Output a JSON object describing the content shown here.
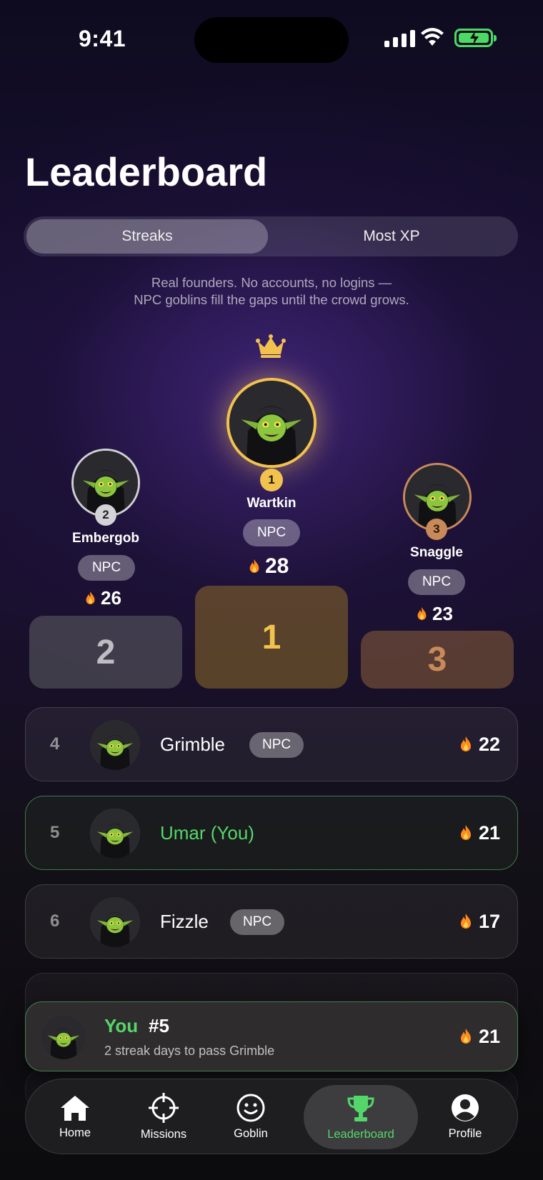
{
  "status_bar": {
    "time": "9:41"
  },
  "page": {
    "title": "Leaderboard",
    "tabs": [
      {
        "label": "Streaks",
        "active": true
      },
      {
        "label": "Most XP",
        "active": false
      }
    ],
    "note_line1": "Real founders. No accounts, no logins —",
    "note_line2": "NPC goblins fill the gaps until the crowd grows."
  },
  "podium": {
    "first": {
      "rank": "1",
      "name": "Wartkin",
      "badge": "NPC",
      "streak": "28",
      "block_label": "1"
    },
    "second": {
      "rank": "2",
      "name": "Embergob",
      "badge": "NPC",
      "streak": "26",
      "block_label": "2"
    },
    "third": {
      "rank": "3",
      "name": "Snaggle",
      "badge": "NPC",
      "streak": "23",
      "block_label": "3"
    }
  },
  "list": [
    {
      "rank": "4",
      "name": "Grimble",
      "badge": "NPC",
      "streak": "22"
    },
    {
      "rank": "5",
      "name": "Umar (You)",
      "badge": "",
      "streak": "21",
      "is_you": true
    },
    {
      "rank": "6",
      "name": "Fizzle",
      "badge": "NPC",
      "streak": "17"
    }
  ],
  "you_card": {
    "label": "You",
    "rank": "#5",
    "subtitle": "2 streak days to pass Grimble",
    "streak": "21"
  },
  "tabbar": {
    "items": [
      {
        "label": "Home",
        "icon": "home-icon"
      },
      {
        "label": "Missions",
        "icon": "crosshair-icon"
      },
      {
        "label": "Goblin",
        "icon": "smiley-icon"
      },
      {
        "label": "Leaderboard",
        "icon": "trophy-icon",
        "active": true
      },
      {
        "label": "Profile",
        "icon": "profile-icon"
      }
    ]
  },
  "colors": {
    "accent_green": "#55d66a",
    "gold": "#f2c24f",
    "silver": "#cfcfd4",
    "bronze": "#c98a5a"
  }
}
